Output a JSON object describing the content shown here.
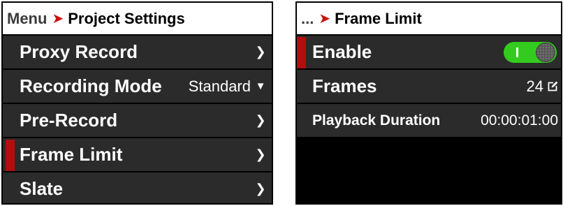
{
  "left_panel": {
    "breadcrumb": "Menu",
    "title": "Project Settings",
    "items": [
      {
        "label": "Proxy Record"
      },
      {
        "label": "Recording Mode",
        "value": "Standard"
      },
      {
        "label": "Pre-Record"
      },
      {
        "label": "Frame Limit"
      },
      {
        "label": "Slate"
      }
    ]
  },
  "right_panel": {
    "breadcrumb": "...",
    "title": "Frame Limit",
    "enable": {
      "label": "Enable",
      "state": "on"
    },
    "frames": {
      "label": "Frames",
      "value": "24"
    },
    "playback": {
      "label": "Playback Duration",
      "value": "00:00:01:00"
    }
  },
  "colors": {
    "accent_red": "#b30d0d",
    "toggle_green": "#33cc1e",
    "row_background": "#2b2b2b"
  },
  "icons": {
    "breadcrumb_separator": "chevron-right-icon",
    "submenu": "chevron-right-icon",
    "dropdown": "chevron-down-icon",
    "edit": "edit-icon"
  }
}
